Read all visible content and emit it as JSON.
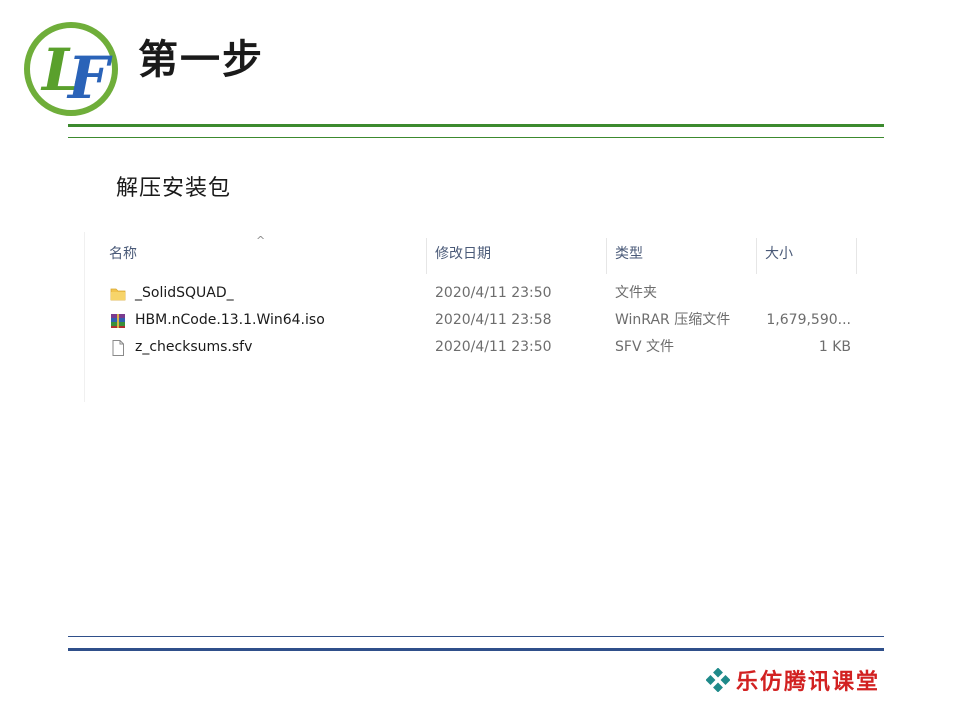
{
  "slide": {
    "title": "第一步",
    "subtitle": "解压安装包",
    "logo_letters": "LF",
    "footer_brand": "乐仿腾讯课堂"
  },
  "colors": {
    "top_rule": "#3c8a2e",
    "bottom_rule": "#2f4f8a",
    "brand": "#d22121"
  },
  "explorer": {
    "sort_indicator": "^",
    "columns": {
      "name": "名称",
      "date": "修改日期",
      "type": "类型",
      "size": "大小"
    },
    "files": [
      {
        "icon": "folder-icon",
        "name": "_SolidSQUAD_",
        "date": "2020/4/11 23:50",
        "type": "文件夹",
        "size": ""
      },
      {
        "icon": "winrar-archive-icon",
        "name": "HBM.nCode.13.1.Win64.iso",
        "date": "2020/4/11 23:58",
        "type": "WinRAR 压缩文件",
        "size": "1,679,590..."
      },
      {
        "icon": "file-icon",
        "name": "z_checksums.sfv",
        "date": "2020/4/11 23:50",
        "type": "SFV 文件",
        "size": "1 KB"
      }
    ]
  }
}
